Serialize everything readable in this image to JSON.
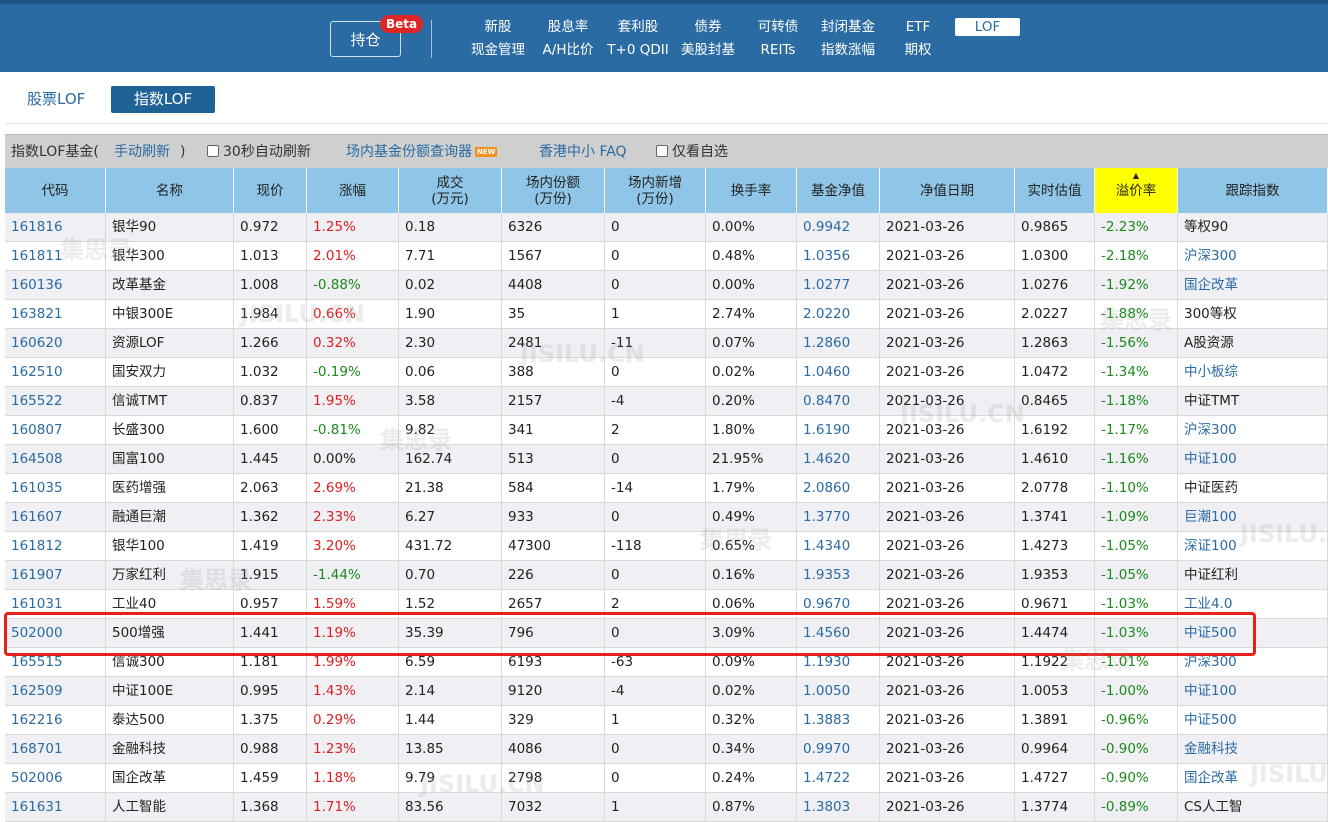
{
  "nav": {
    "hold_label": "持仓",
    "beta_label": "Beta",
    "items_row1": [
      "新股",
      "股息率",
      "套利股",
      "债券",
      "可转债",
      "封闭基金",
      "ETF"
    ],
    "items_row2": [
      "现金管理",
      "A/H比价",
      "T+0 QDII",
      "美股封基",
      "REITs",
      "指数涨幅",
      "期权"
    ],
    "active_label": "LOF"
  },
  "subtabs": [
    "股票LOF",
    "指数LOF"
  ],
  "toolbar": {
    "label": "指数LOF基金(",
    "manual_refresh": "手动刷新",
    "close_paren": ")",
    "auto_refresh": "30秒自动刷新",
    "query_tool": "场内基金份额查询器",
    "new_badge": "NEW",
    "faq": "香港中小 FAQ",
    "only_selected": "仅看自选"
  },
  "columns": [
    "代码",
    "名称",
    "现价",
    "涨幅",
    "成交\n(万元)",
    "场内份额\n(万份)",
    "场内新增\n(万份)",
    "换手率",
    "基金净值",
    "净值日期",
    "实时估值",
    "溢价率",
    "跟踪指数"
  ],
  "rows": [
    [
      "161816",
      "银华90",
      "0.972",
      "1.25%",
      "0.18",
      "6326",
      "0",
      "0.00%",
      "0.9942",
      "2021-03-26",
      "0.9865",
      "-2.23%",
      "等权90"
    ],
    [
      "161811",
      "银华300",
      "1.013",
      "2.01%",
      "7.71",
      "1567",
      "0",
      "0.48%",
      "1.0356",
      "2021-03-26",
      "1.0300",
      "-2.18%",
      "沪深300"
    ],
    [
      "160136",
      "改革基金",
      "1.008",
      "-0.88%",
      "0.02",
      "4408",
      "0",
      "0.00%",
      "1.0277",
      "2021-03-26",
      "1.0276",
      "-1.92%",
      "国企改革"
    ],
    [
      "163821",
      "中银300E",
      "1.984",
      "0.66%",
      "1.90",
      "35",
      "1",
      "2.74%",
      "2.0220",
      "2021-03-26",
      "2.0227",
      "-1.88%",
      "300等权"
    ],
    [
      "160620",
      "资源LOF",
      "1.266",
      "0.32%",
      "2.30",
      "2481",
      "-11",
      "0.07%",
      "1.2860",
      "2021-03-26",
      "1.2863",
      "-1.56%",
      "A股资源"
    ],
    [
      "162510",
      "国安双力",
      "1.032",
      "-0.19%",
      "0.06",
      "388",
      "0",
      "0.02%",
      "1.0460",
      "2021-03-26",
      "1.0472",
      "-1.34%",
      "中小板综"
    ],
    [
      "165522",
      "信诚TMT",
      "0.837",
      "1.95%",
      "3.58",
      "2157",
      "-4",
      "0.20%",
      "0.8470",
      "2021-03-26",
      "0.8465",
      "-1.18%",
      "中证TMT"
    ],
    [
      "160807",
      "长盛300",
      "1.600",
      "-0.81%",
      "9.82",
      "341",
      "2",
      "1.80%",
      "1.6190",
      "2021-03-26",
      "1.6192",
      "-1.17%",
      "沪深300"
    ],
    [
      "164508",
      "国富100",
      "1.445",
      "0.00%",
      "162.74",
      "513",
      "0",
      "21.95%",
      "1.4620",
      "2021-03-26",
      "1.4610",
      "-1.16%",
      "中证100"
    ],
    [
      "161035",
      "医药增强",
      "2.063",
      "2.69%",
      "21.38",
      "584",
      "-14",
      "1.79%",
      "2.0860",
      "2021-03-26",
      "2.0778",
      "-1.10%",
      "中证医药"
    ],
    [
      "161607",
      "融通巨潮",
      "1.362",
      "2.33%",
      "6.27",
      "933",
      "0",
      "0.49%",
      "1.3770",
      "2021-03-26",
      "1.3741",
      "-1.09%",
      "巨潮100"
    ],
    [
      "161812",
      "银华100",
      "1.419",
      "3.20%",
      "431.72",
      "47300",
      "-118",
      "0.65%",
      "1.4340",
      "2021-03-26",
      "1.4273",
      "-1.05%",
      "深证100"
    ],
    [
      "161907",
      "万家红利",
      "1.915",
      "-1.44%",
      "0.70",
      "226",
      "0",
      "0.16%",
      "1.9353",
      "2021-03-26",
      "1.9353",
      "-1.05%",
      "中证红利"
    ],
    [
      "161031",
      "工业40",
      "0.957",
      "1.59%",
      "1.52",
      "2657",
      "2",
      "0.06%",
      "0.9670",
      "2021-03-26",
      "0.9671",
      "-1.03%",
      "工业4.0"
    ],
    [
      "502000",
      "500增强",
      "1.441",
      "1.19%",
      "35.39",
      "796",
      "0",
      "3.09%",
      "1.4560",
      "2021-03-26",
      "1.4474",
      "-1.03%",
      "中证500"
    ],
    [
      "165515",
      "信诚300",
      "1.181",
      "1.99%",
      "6.59",
      "6193",
      "-63",
      "0.09%",
      "1.1930",
      "2021-03-26",
      "1.1922",
      "-1.01%",
      "沪深300"
    ],
    [
      "162509",
      "中证100E",
      "0.995",
      "1.43%",
      "2.14",
      "9120",
      "-4",
      "0.02%",
      "1.0050",
      "2021-03-26",
      "1.0053",
      "-1.00%",
      "中证100"
    ],
    [
      "162216",
      "泰达500",
      "1.375",
      "0.29%",
      "1.44",
      "329",
      "1",
      "0.32%",
      "1.3883",
      "2021-03-26",
      "1.3891",
      "-0.96%",
      "中证500"
    ],
    [
      "168701",
      "金融科技",
      "0.988",
      "1.23%",
      "13.85",
      "4086",
      "0",
      "0.34%",
      "0.9970",
      "2021-03-26",
      "0.9964",
      "-0.90%",
      "金融科技"
    ],
    [
      "502006",
      "国企改革",
      "1.459",
      "1.18%",
      "9.79",
      "2798",
      "0",
      "0.24%",
      "1.4722",
      "2021-03-26",
      "1.4727",
      "-0.90%",
      "国企改革"
    ],
    [
      "161631",
      "人工智能",
      "1.368",
      "1.71%",
      "83.56",
      "7032",
      "1",
      "0.87%",
      "1.3803",
      "2021-03-26",
      "1.3774",
      "-0.89%",
      "CS人工智"
    ]
  ],
  "linked_index": [
    false,
    true,
    true,
    false,
    false,
    true,
    false,
    true,
    true,
    false,
    true,
    true,
    false,
    true,
    true,
    true,
    true,
    true,
    true,
    true,
    false
  ],
  "highlighted_code": "502000",
  "colors": {
    "nav_bg": "#2a6ba3",
    "header_bg": "#8fc6e7",
    "sorted_header": "#ffff00",
    "up": "#e02020",
    "down": "#1b8a1b",
    "link": "#2a6ba3",
    "highlight": "#e8201c"
  },
  "watermarks": [
    "集思录",
    "JISILU.CN"
  ]
}
